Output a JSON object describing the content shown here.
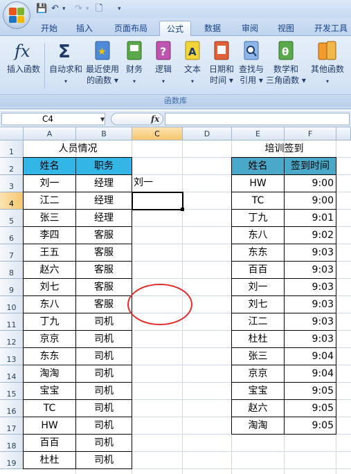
{
  "quick_access": {
    "save": "💾",
    "undo": "↶",
    "undo_dropdown": "▾",
    "redo": "↷",
    "redo_dropdown": "▾",
    "print_preview": "🗋",
    "customize": "▾"
  },
  "tabs": [
    "开始",
    "插入",
    "页面布局",
    "公式",
    "数据",
    "审阅",
    "视图",
    "开发工具"
  ],
  "active_tab": "公式",
  "ribbon": {
    "insert_function": "插入函数",
    "autosum": [
      "自动求和",
      "▾"
    ],
    "recent": [
      "最近使用",
      "的函数 ▾"
    ],
    "financial": [
      "财务",
      "▾"
    ],
    "logical": [
      "逻辑",
      "▾"
    ],
    "text": [
      "文本",
      "▾"
    ],
    "datetime": [
      "日期和",
      "时间 ▾"
    ],
    "lookup": [
      "查找与",
      "引用 ▾"
    ],
    "math": [
      "数学和",
      "三角函数 ▾"
    ],
    "more": [
      "其他函数",
      "▾"
    ],
    "group_label": "函数库"
  },
  "formula_bar": {
    "name_box": "C4",
    "fx": "fx",
    "formula": ""
  },
  "columns": [
    "A",
    "B",
    "C",
    "D",
    "E",
    "F"
  ],
  "selected_column": "C",
  "rows": [
    "1",
    "2",
    "3",
    "4",
    "5",
    "6",
    "7",
    "8",
    "9",
    "10",
    "11",
    "12",
    "13",
    "14",
    "15",
    "16",
    "17",
    "18",
    "19"
  ],
  "selected_row": "4",
  "table1": {
    "title": "人员情况",
    "headers": [
      "姓名",
      "职务"
    ],
    "rows": [
      [
        "刘一",
        "经理"
      ],
      [
        "江二",
        "经理"
      ],
      [
        "张三",
        "经理"
      ],
      [
        "李四",
        "客服"
      ],
      [
        "王五",
        "客服"
      ],
      [
        "赵六",
        "客服"
      ],
      [
        "刘七",
        "客服"
      ],
      [
        "东八",
        "客服"
      ],
      [
        "丁九",
        "司机"
      ],
      [
        "京京",
        "司机"
      ],
      [
        "东东",
        "司机"
      ],
      [
        "淘淘",
        "司机"
      ],
      [
        "宝宝",
        "司机"
      ],
      [
        "TC",
        "司机"
      ],
      [
        "HW",
        "司机"
      ],
      [
        "百百",
        "司机"
      ],
      [
        "杜杜",
        "司机"
      ]
    ]
  },
  "cell_C3": "刘一",
  "table2": {
    "title": "培训签到",
    "headers": [
      "姓名",
      "签到时间"
    ],
    "rows": [
      [
        "HW",
        "9:00"
      ],
      [
        "TC",
        "9:00"
      ],
      [
        "丁九",
        "9:01"
      ],
      [
        "东八",
        "9:02"
      ],
      [
        "东东",
        "9:03"
      ],
      [
        "百百",
        "9:03"
      ],
      [
        "刘一",
        "9:03"
      ],
      [
        "刘七",
        "9:03"
      ],
      [
        "江二",
        "9:03"
      ],
      [
        "杜杜",
        "9:03"
      ],
      [
        "张三",
        "9:04"
      ],
      [
        "京京",
        "9:04"
      ],
      [
        "宝宝",
        "9:05"
      ],
      [
        "赵六",
        "9:05"
      ],
      [
        "淘淘",
        "9:05"
      ]
    ]
  },
  "colors": {
    "header_blue": "#33b5e5",
    "header_teal": "#4aa9c8",
    "annotation_red": "#e32b2b"
  }
}
